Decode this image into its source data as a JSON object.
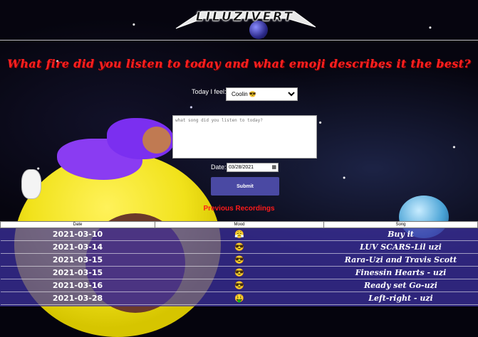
{
  "header": {
    "logo_text": "LILUZIVERT"
  },
  "headline": "What fire did you listen to today and what emoji describes it the best?",
  "form": {
    "feel_label": "Today I feel:",
    "mood_selected": "Coolin 😎",
    "song_placeholder": "what song did you listen to today?",
    "date_label": "Date:",
    "date_value": "03/28/2021",
    "submit_label": "Submit"
  },
  "previous_title": "Previous Recordings",
  "table": {
    "headers": [
      "Date",
      "Mood",
      "Song"
    ],
    "rows": [
      {
        "date": "2021-03-10",
        "mood": "😤",
        "song": "Buy it"
      },
      {
        "date": "2021-03-14",
        "mood": "😎",
        "song": "LUV SCARS-Lil uzi"
      },
      {
        "date": "2021-03-15",
        "mood": "😎",
        "song": "Rara-Uzi and Travis Scott"
      },
      {
        "date": "2021-03-15",
        "mood": "😎",
        "song": "Finessin Hearts - uzi"
      },
      {
        "date": "2021-03-16",
        "mood": "😎",
        "song": "Ready set Go-uzi"
      },
      {
        "date": "2021-03-28",
        "mood": "🤑",
        "song": "Left-right - uzi"
      }
    ]
  }
}
